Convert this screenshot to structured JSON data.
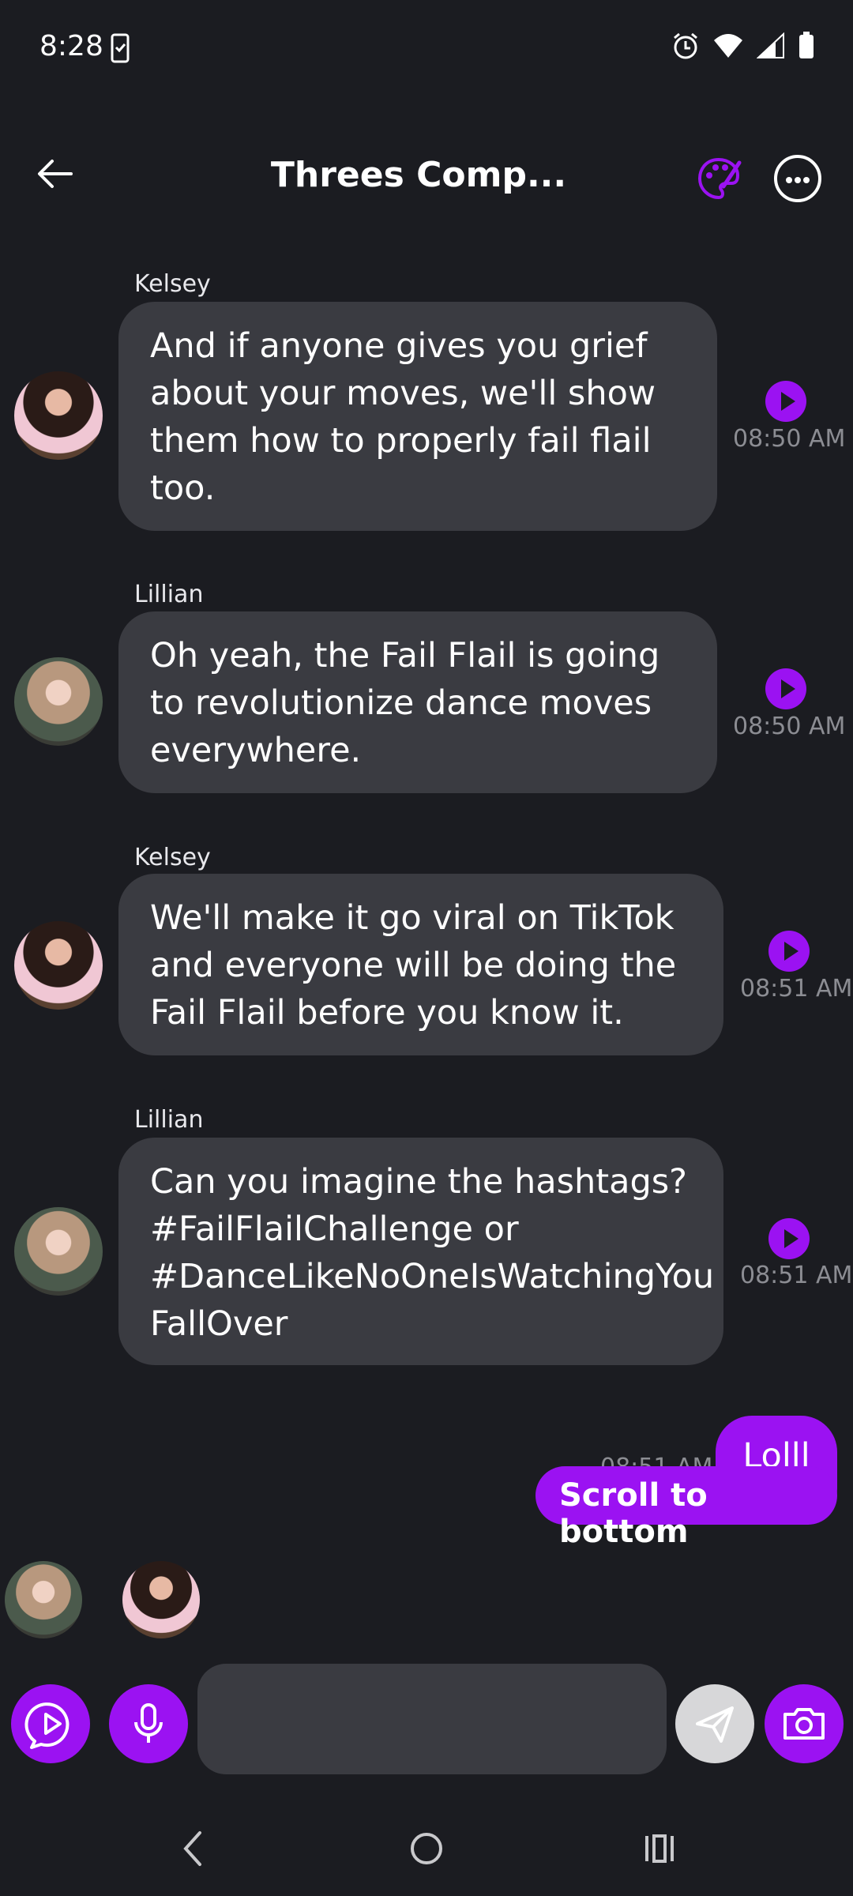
{
  "status_bar": {
    "time": "8:28"
  },
  "header": {
    "title": "Threes Comp..."
  },
  "messages": [
    {
      "sender": "Kelsey",
      "text": "And if anyone gives you grief about your moves, we'll show them how to properly fail flail too.",
      "time": "08:50 AM"
    },
    {
      "sender": "Lillian",
      "text": "Oh yeah, the Fail Flail is going to revolutionize dance moves everywhere.",
      "time": "08:50 AM"
    },
    {
      "sender": "Kelsey",
      "text": "We'll make it go viral on TikTok and everyone will be doing the Fail Flail before you know it.",
      "time": "08:51 AM"
    },
    {
      "sender": "Lillian",
      "text": "Can you imagine the hashtags? #FailFlailChallenge or #DanceLikeNoOneIsWatchingYou FallOver",
      "time": "08:51 AM"
    }
  ],
  "own_message": {
    "text": "Lolll",
    "time": "08:51 AM"
  },
  "scroll_to_bottom": "Scroll to bottom",
  "composer": {
    "placeholder": ""
  },
  "colors": {
    "accent": "#9b12f2",
    "background": "#1b1c21",
    "bubble": "#3a3b41",
    "timestamp": "#8c8d93"
  },
  "icons": [
    "back-arrow-icon",
    "palette-icon",
    "more-icon",
    "play-icon",
    "chat-play-icon",
    "microphone-icon",
    "send-icon",
    "camera-icon",
    "nav-back-icon",
    "nav-home-icon",
    "nav-recents-icon"
  ]
}
